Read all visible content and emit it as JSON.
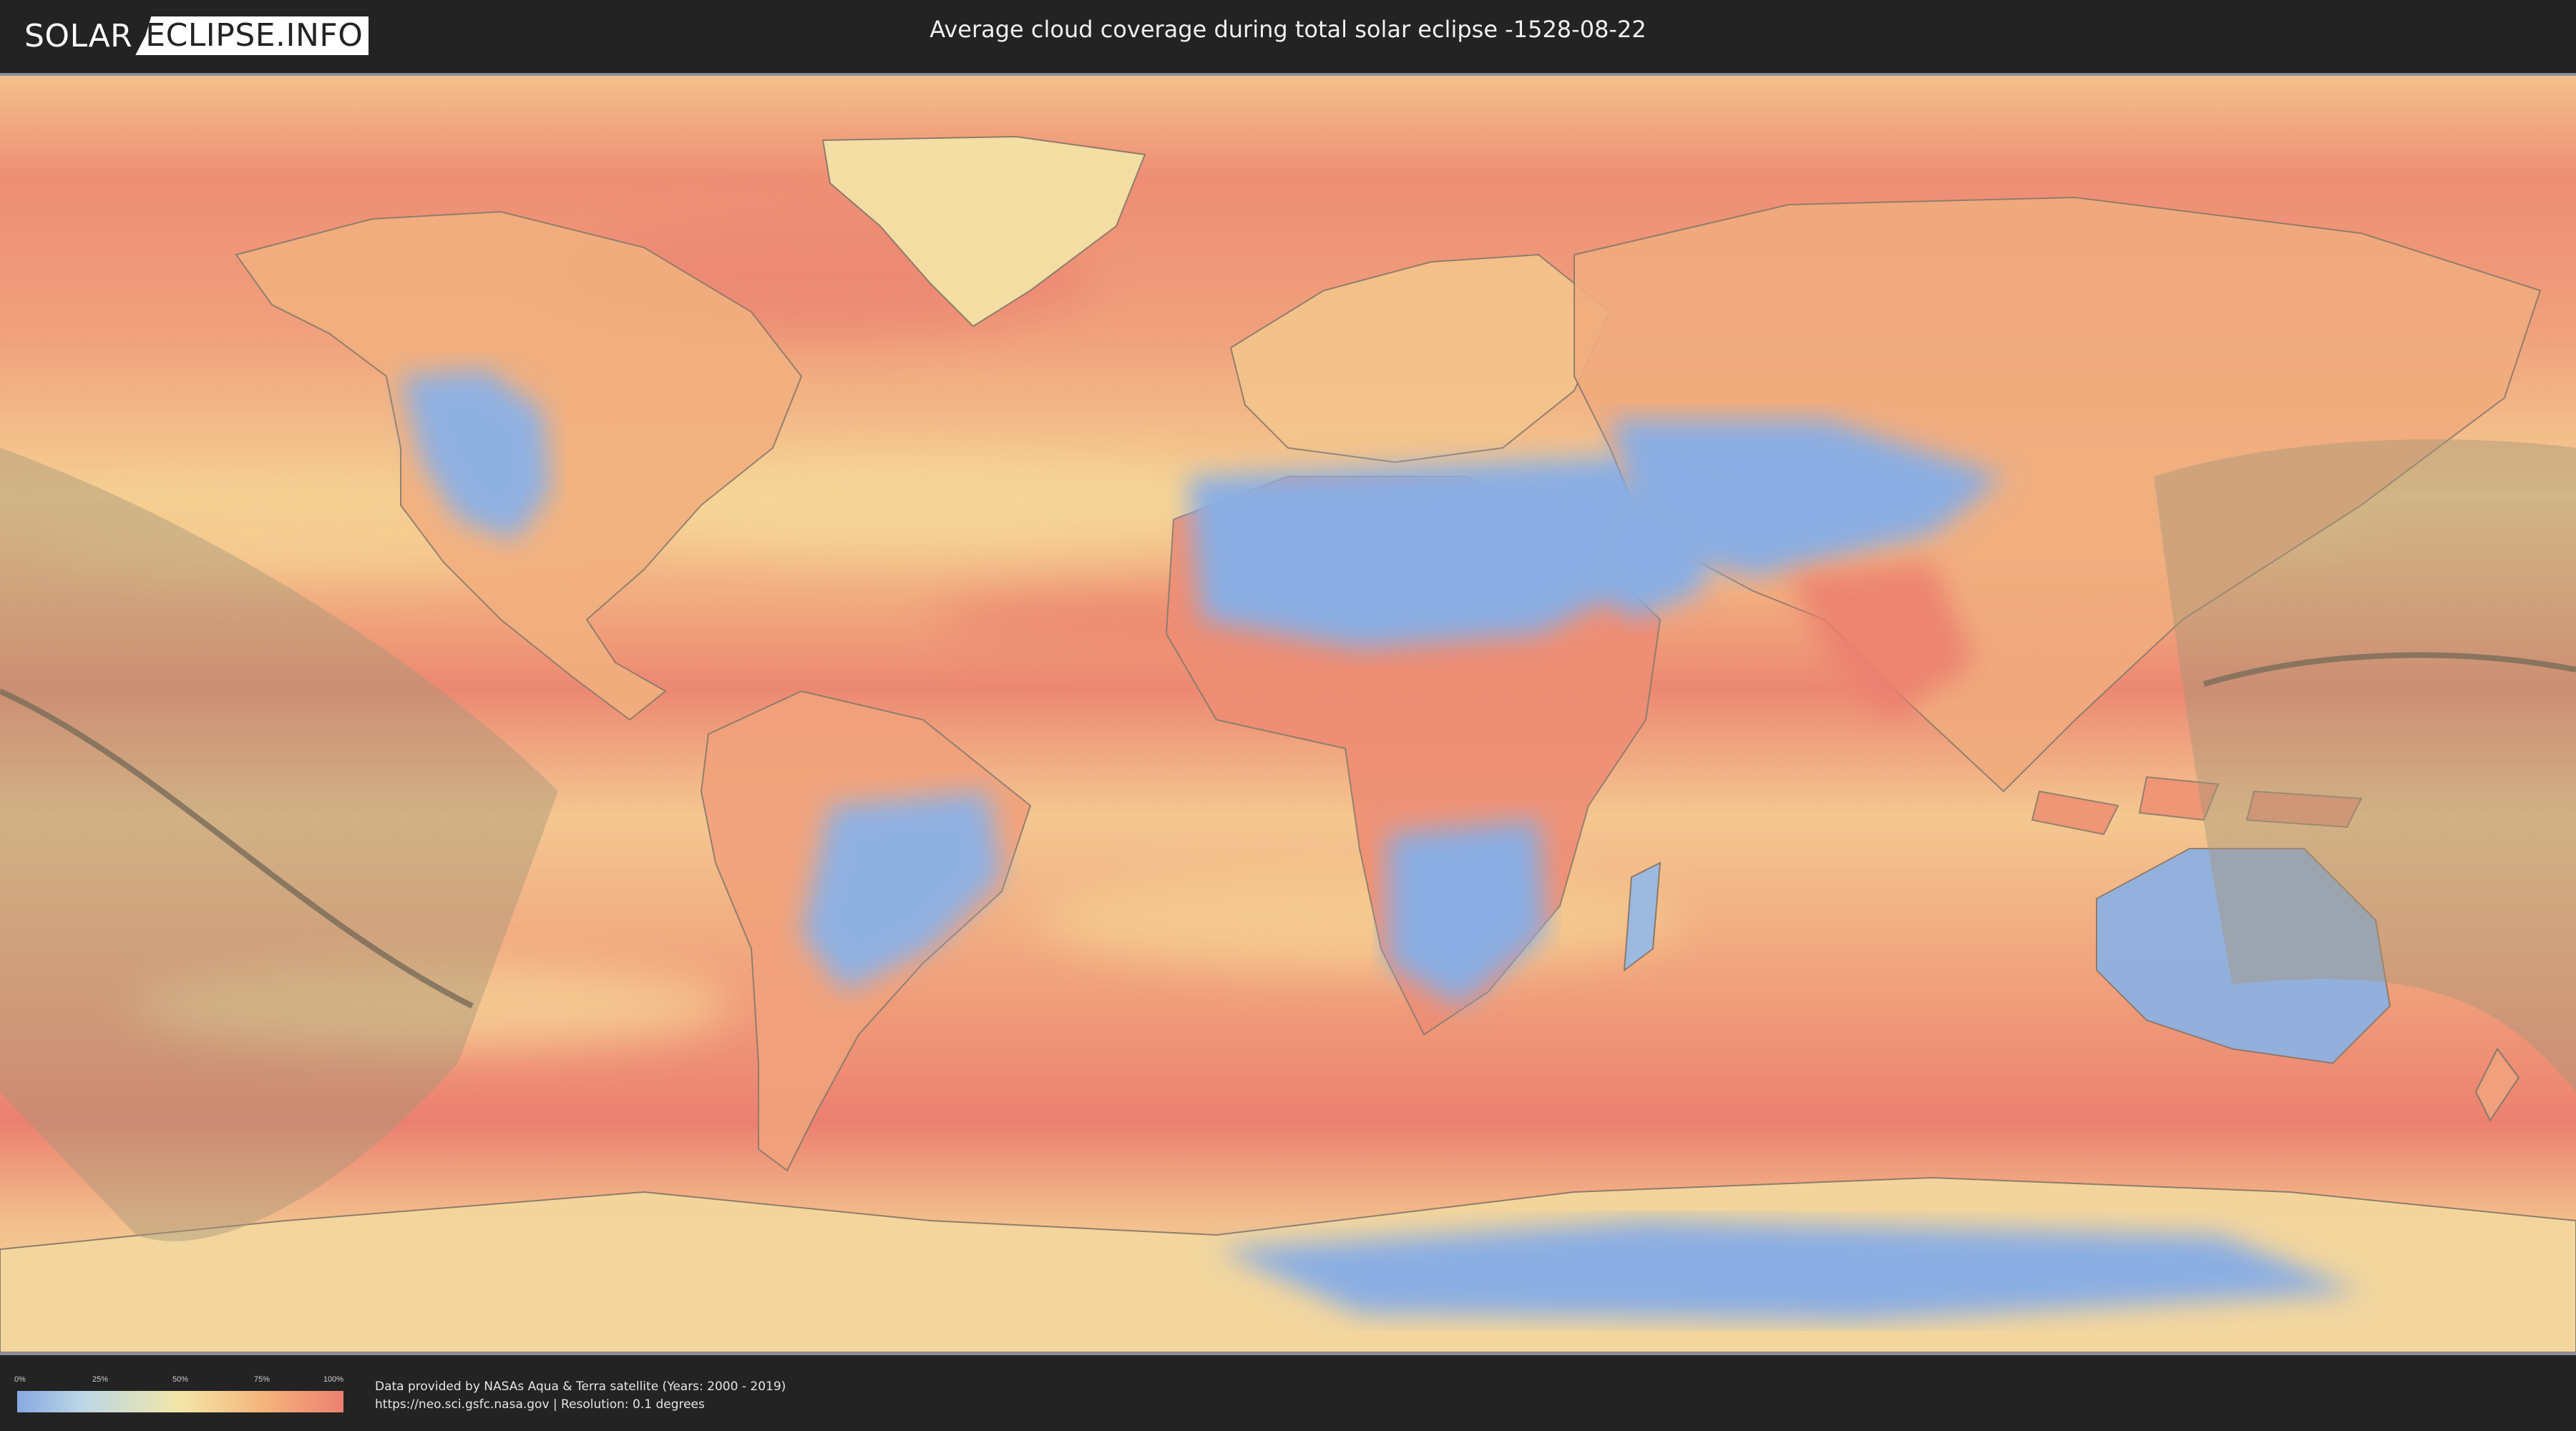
{
  "header": {
    "logo_left": "SOLAR",
    "logo_right": "ECLIPSE.INFO",
    "title": "Average cloud coverage during total solar eclipse -1528-08-22"
  },
  "legend": {
    "ticks": [
      "0%",
      "25%",
      "50%",
      "75%",
      "100%"
    ],
    "colors": [
      "#86a9e2",
      "#bcd7e6",
      "#f2e6a6",
      "#f5b57c",
      "#ec8070"
    ]
  },
  "footer": {
    "credit_line1": "Data provided by NASAs Aqua & Terra satellite (Years: 2000 - 2019)",
    "credit_line2": "https://neo.sci.gsfc.nasa.gov | Resolution: 0.1 degrees"
  },
  "map": {
    "projection": "equirectangular",
    "ocean_color": "#ee8f76",
    "clear_color": "#8aaee3",
    "mid_color": "#f3e1a2",
    "eclipse_band_color": "#a89a78"
  }
}
